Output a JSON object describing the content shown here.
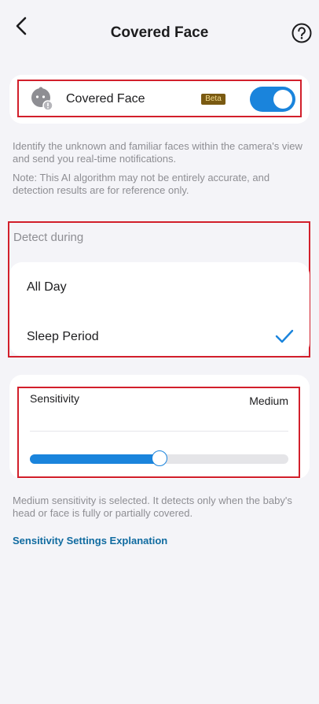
{
  "header": {
    "title": "Covered Face",
    "back_icon": "back-arrow-icon",
    "help_icon": "help-icon"
  },
  "covered_face": {
    "icon": "baby-face-icon",
    "label": "Covered Face",
    "badge": "Beta",
    "enabled": true
  },
  "description": {
    "line1": "Identify the unknown and familiar faces within the camera's view and send you real-time notifications.",
    "note": "Note: This AI algorithm may not be entirely accurate, and detection results are for reference only."
  },
  "detect": {
    "label": "Detect during",
    "options": [
      {
        "label": "All Day",
        "selected": false
      },
      {
        "label": "Sleep Period",
        "selected": true
      }
    ]
  },
  "sensitivity": {
    "label": "Sensitivity",
    "value": "Medium",
    "level": 0.5,
    "help_text": "Medium sensitivity is selected. It detects only when the baby's head or face is fully or partially covered.",
    "link": "Sensitivity Settings Explanation"
  },
  "colors": {
    "accent": "#1a84dc",
    "highlight_border": "#d21f2b",
    "badge_bg": "#7a5a12",
    "link": "#106ba0"
  }
}
